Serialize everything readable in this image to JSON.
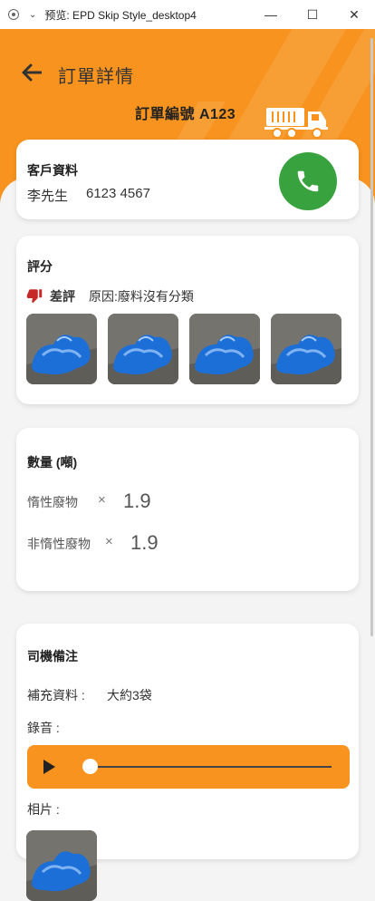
{
  "window": {
    "title": "预览: EPD Skip Style_desktop4",
    "minimize_label": "—",
    "maximize_label": "☐",
    "close_label": "✕"
  },
  "header": {
    "back_icon": "arrow-left-icon",
    "title": "訂單詳情",
    "order_number": "訂單編號 A123",
    "truck_icon": "truck-icon",
    "bg_color": "#f7931e"
  },
  "customer": {
    "title": "客戶資料",
    "name": "李先生",
    "phone": "6123 4567",
    "call_icon": "phone-icon",
    "call_color": "#38a33e"
  },
  "rating": {
    "title": "評分",
    "icon": "thumbs-down-icon",
    "verdict": "差評",
    "reason": "原因:廢料沒有分類",
    "icon_color": "#c62828",
    "photo_count": 4
  },
  "quantity": {
    "title": "數量 (噸)",
    "items": [
      {
        "label": "惰性廢物",
        "times": "×",
        "value": "1.9"
      },
      {
        "label": "非惰性廢物",
        "times": "×",
        "value": "1.9"
      }
    ]
  },
  "driver_notes": {
    "title": "司機備注",
    "extra_label": "補充資料 :",
    "extra_value": "大約3袋",
    "recording_label": "錄音 :",
    "photos_label": "相片 :",
    "audio_progress": 0,
    "audio_color": "#f7931e"
  }
}
